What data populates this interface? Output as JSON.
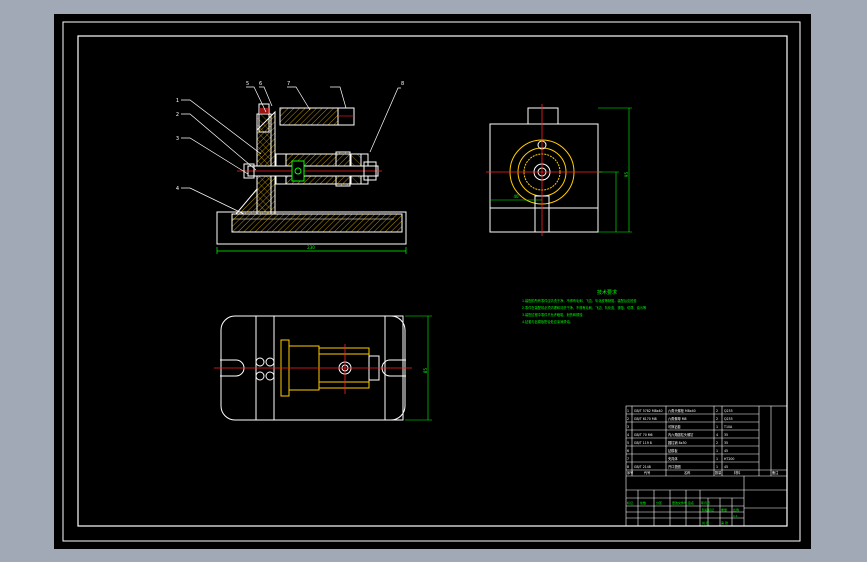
{
  "title_block": {
    "rows": [
      {
        "seq": "1",
        "code": "GB/T 5782 M8x40",
        "name": "六角头螺栓 M8x40",
        "qty": "2",
        "note": "Q235"
      },
      {
        "seq": "2",
        "code": "GB/T 6170 M8",
        "name": "六角螺母 M8",
        "qty": "2",
        "note": "Q235"
      },
      {
        "seq": "3",
        "code": "",
        "name": "可换钻套",
        "qty": "1",
        "note": "T10A"
      },
      {
        "seq": "4",
        "code": "GB/T 70 M6",
        "name": "内六角圆柱头螺钉",
        "qty": "4",
        "note": "35"
      },
      {
        "seq": "5",
        "code": "GB/T 119 8",
        "name": "圆柱销 8x30",
        "qty": "2",
        "note": "35"
      },
      {
        "seq": "6",
        "code": "",
        "name": "钻模板",
        "qty": "1",
        "note": "45"
      },
      {
        "seq": "7",
        "code": "",
        "name": "夹具体",
        "qty": "1",
        "note": "HT200"
      },
      {
        "seq": "8",
        "code": "GB/T 2148",
        "name": "开口垫圈",
        "qty": "1",
        "note": "45"
      }
    ],
    "header": {
      "seq": "序号",
      "code": "代号",
      "name": "名称",
      "qty": "数量",
      "material": "材料",
      "remark": "备注"
    },
    "sign_row": [
      "标记",
      "处数",
      "分区",
      "更改文件号",
      "签名",
      "年月日"
    ],
    "scale_labels": [
      "阶段标记",
      "重量",
      "比例"
    ],
    "scale_value": "1:1",
    "sheet": [
      "共 张",
      "第 张"
    ]
  },
  "notes": {
    "heading": "技术要求",
    "lines": [
      "1.装配前所有零件应清洗干净，不得有毛刺、飞边、氧化皮等缺陷，装配后应检查",
      "2.零件在装配前必须清理和清洗干净，不得有毛刺、飞边、氧化皮、锈蚀、切屑、油污等",
      "3.装配过程中零件不允许磕碰、划伤和锈蚀",
      "4.钻套与钻模板配合处应涂润滑油。"
    ]
  },
  "callouts": [
    "1",
    "2",
    "3",
    "4",
    "5",
    "6",
    "7",
    "8"
  ],
  "dimensions": {
    "front_width": "230",
    "side_height": "95",
    "side_offset": "40",
    "top_height": "85"
  },
  "colors": {
    "outline": "#ffffff",
    "centerline": "#ff2020",
    "dimension": "#00ff00",
    "hatch": "#ffcc00",
    "text": "#ffffff",
    "notes": "#00ff00",
    "background": "#000000",
    "frame": "#a2a9b6"
  }
}
